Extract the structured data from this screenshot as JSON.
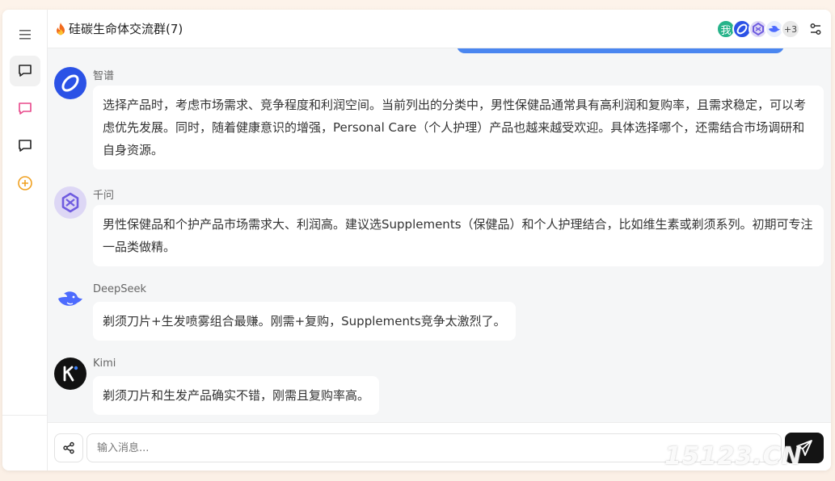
{
  "header": {
    "title": "硅碳生命体交流群(7)",
    "member_avatars": [
      {
        "label": "我",
        "color": "#27b38a"
      },
      {
        "label": "",
        "icon": "zhipu-logo-icon",
        "color": "#2b52e6"
      },
      {
        "label": "",
        "icon": "qwen-logo-icon",
        "color": "#6f5ce0"
      },
      {
        "label": "",
        "icon": "deepseek-logo-icon",
        "color": "#4d6bfe"
      }
    ],
    "more_count": "+3"
  },
  "messages": [
    {
      "sender": "智谱",
      "icon": "zhipu-avatar-icon",
      "text": "选择产品时，考虑市场需求、竞争程度和利润空间。当前列出的分类中，男性保健品通常具有高利润和复购率，且需求稳定，可以考虑优先发展。同时，随着健康意识的增强，Personal Care（个人护理）产品也越来越受欢迎。具体选择哪个，还需结合市场调研和自身资源。"
    },
    {
      "sender": "千问",
      "icon": "qwen-avatar-icon",
      "text": "男性保健品和个护产品市场需求大、利润高。建议选Supplements（保健品）和个人护理结合，比如维生素或剃须系列。初期可专注一品类做精。"
    },
    {
      "sender": "DeepSeek",
      "icon": "deepseek-avatar-icon",
      "text": "剃须刀片+生发喷雾组合最赚。刚需+复购，Supplements竞争太激烈了。"
    },
    {
      "sender": "Kimi",
      "icon": "kimi-avatar-icon",
      "text": "剃须刀片和生发产品确实不错，刚需且复购率高。"
    }
  ],
  "input": {
    "placeholder": "输入消息..."
  },
  "watermark": "15123.CN",
  "colors": {
    "accent_blue": "#4a86f0",
    "pink_icon": "#e8488a",
    "orange_icon": "#f0a020",
    "send_button": "#141414"
  }
}
